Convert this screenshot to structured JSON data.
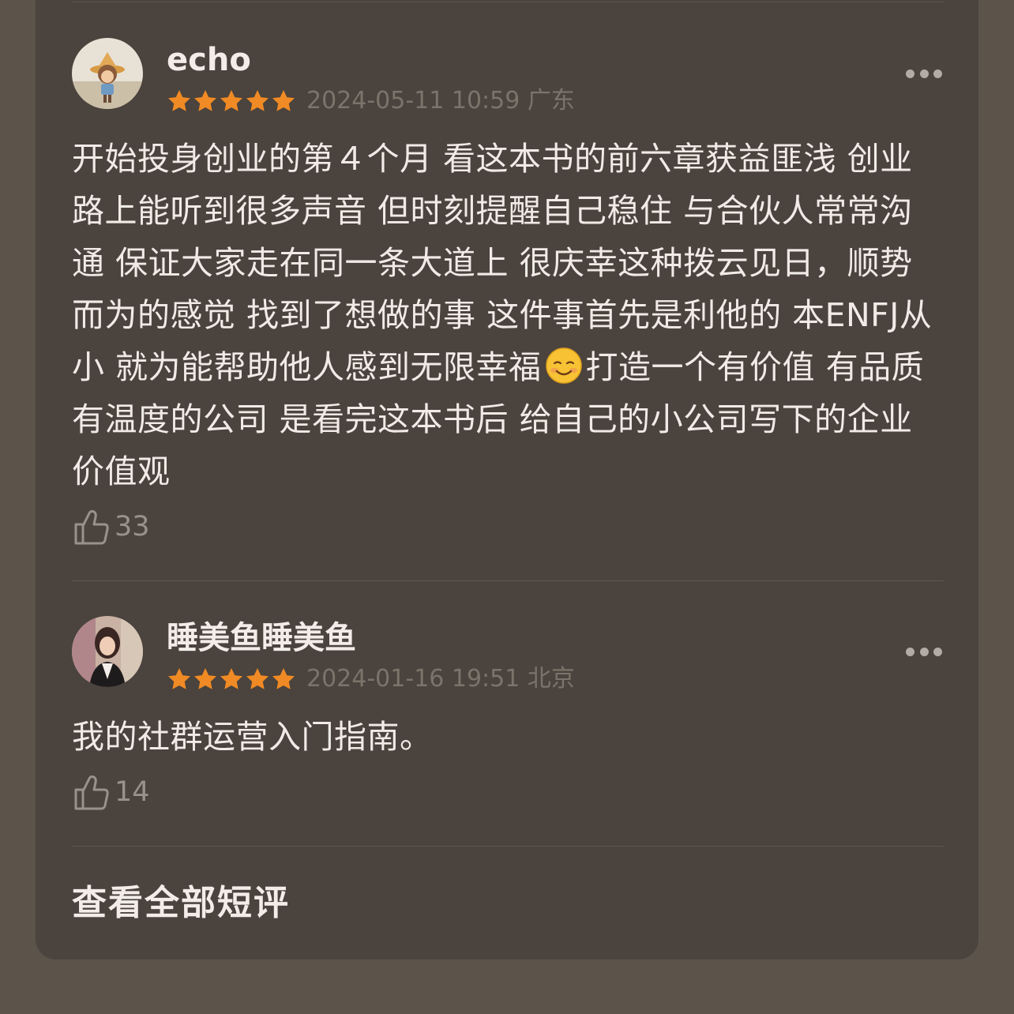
{
  "reviews": [
    {
      "username": "echo",
      "rating": 5,
      "datetime": "2024-05-11 10:59",
      "location": "广东",
      "text_before_emoji": "开始投身创业的第４个月 看这本书的前六章获益匪浅 创业路上能听到很多声音 但时刻提醒自己稳住 与合伙人常常沟通 保证大家走在同一条大道上 很庆幸这种拨云见日，顺势而为的感觉 找到了想做的事 这件事首先是利他的 本ENFJ从小 就为能帮助他人感到无限幸福",
      "emoji": "smiling-face-emoji",
      "text_after_emoji": "打造一个有价值 有品质 有温度的公司 是看完这本书后 给自己的小公司写下的企业价值观",
      "likes": "33"
    },
    {
      "username": "睡美鱼睡美鱼",
      "rating": 5,
      "datetime": "2024-01-16 19:51",
      "location": "北京",
      "text": "我的社群运营入门指南。",
      "likes": "14"
    }
  ],
  "footer": {
    "view_all_label": "查看全部短评"
  },
  "icons": {
    "star": "star-icon",
    "more": "more-icon",
    "like": "thumbs-up-icon"
  },
  "colors": {
    "page_bg": "#5c534b",
    "card_bg": "#4b433d",
    "star": "#f08a24",
    "text": "#f0ebe6",
    "meta": "#7c736b"
  }
}
